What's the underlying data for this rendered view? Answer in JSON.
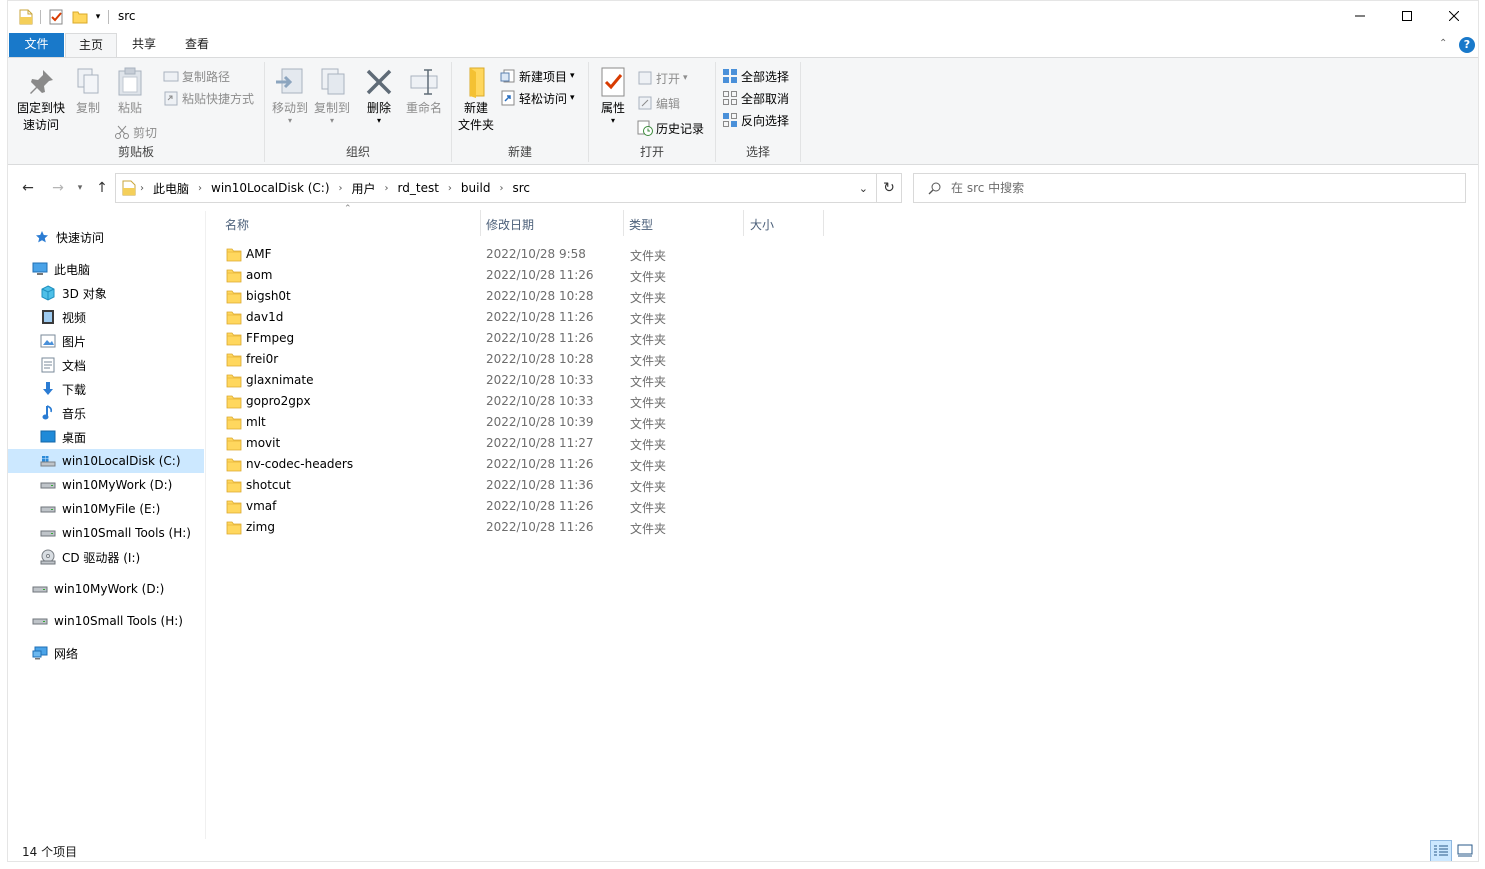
{
  "window": {
    "title": "src",
    "controls": {
      "minimize": "minimize",
      "maximize": "maximize",
      "close": "close"
    }
  },
  "tabs": [
    {
      "label": "文件"
    },
    {
      "label": "主页"
    },
    {
      "label": "共享"
    },
    {
      "label": "查看"
    }
  ],
  "ribbon": {
    "clipboard": {
      "label": "剪贴板",
      "pin": "固定到快\n速访问",
      "pin_line1": "固定到快",
      "pin_line2": "速访问",
      "copy": "复制",
      "paste": "粘贴",
      "copy_path": "复制路径",
      "paste_shortcut": "粘贴快捷方式",
      "cut": "剪切"
    },
    "organize": {
      "label": "组织",
      "move_to": "移动到",
      "copy_to": "复制到",
      "delete": "删除",
      "rename": "重命名"
    },
    "new": {
      "label": "新建",
      "new_folder_line1": "新建",
      "new_folder_line2": "文件夹",
      "new_item": "新建项目",
      "easy_access": "轻松访问"
    },
    "open": {
      "label": "打开",
      "properties": "属性",
      "open": "打开",
      "edit": "编辑",
      "history": "历史记录"
    },
    "select": {
      "label": "选择",
      "select_all": "全部选择",
      "select_none": "全部取消",
      "invert": "反向选择"
    }
  },
  "address": {
    "crumbs": [
      "此电脑",
      "win10LocalDisk (C:)",
      "用户",
      "rd_test",
      "build",
      "src"
    ]
  },
  "search": {
    "placeholder": "在 src 中搜索"
  },
  "nav": {
    "quick_access": "快速访问",
    "this_pc": "此电脑",
    "items": [
      {
        "label": "3D 对象",
        "icon": "3d-objects-icon"
      },
      {
        "label": "视频",
        "icon": "video-icon"
      },
      {
        "label": "图片",
        "icon": "pictures-icon"
      },
      {
        "label": "文档",
        "icon": "documents-icon"
      },
      {
        "label": "下载",
        "icon": "download-icon"
      },
      {
        "label": "音乐",
        "icon": "music-icon"
      },
      {
        "label": "桌面",
        "icon": "desktop-icon"
      },
      {
        "label": "win10LocalDisk (C:)",
        "icon": "drive-icon"
      },
      {
        "label": "win10MyWork (D:)",
        "icon": "drive-icon"
      },
      {
        "label": "win10MyFile (E:)",
        "icon": "drive-icon"
      },
      {
        "label": "win10Small Tools (H:)",
        "icon": "drive-icon"
      },
      {
        "label": "CD 驱动器 (I:)",
        "icon": "cd-drive-icon"
      }
    ],
    "extra": [
      {
        "label": "win10MyWork (D:)"
      },
      {
        "label": "win10Small Tools (H:)"
      }
    ],
    "network": "网络"
  },
  "columns": {
    "name": "名称",
    "date": "修改日期",
    "type": "类型",
    "size": "大小"
  },
  "files": [
    {
      "name": "AMF",
      "date": "2022/10/28 9:58",
      "type": "文件夹"
    },
    {
      "name": "aom",
      "date": "2022/10/28 11:26",
      "type": "文件夹"
    },
    {
      "name": "bigsh0t",
      "date": "2022/10/28 10:28",
      "type": "文件夹"
    },
    {
      "name": "dav1d",
      "date": "2022/10/28 11:26",
      "type": "文件夹"
    },
    {
      "name": "FFmpeg",
      "date": "2022/10/28 11:26",
      "type": "文件夹"
    },
    {
      "name": "frei0r",
      "date": "2022/10/28 10:28",
      "type": "文件夹"
    },
    {
      "name": "glaxnimate",
      "date": "2022/10/28 10:33",
      "type": "文件夹"
    },
    {
      "name": "gopro2gpx",
      "date": "2022/10/28 10:33",
      "type": "文件夹"
    },
    {
      "name": "mlt",
      "date": "2022/10/28 10:39",
      "type": "文件夹"
    },
    {
      "name": "movit",
      "date": "2022/10/28 11:27",
      "type": "文件夹"
    },
    {
      "name": "nv-codec-headers",
      "date": "2022/10/28 11:26",
      "type": "文件夹"
    },
    {
      "name": "shotcut",
      "date": "2022/10/28 11:36",
      "type": "文件夹"
    },
    {
      "name": "vmaf",
      "date": "2022/10/28 11:26",
      "type": "文件夹"
    },
    {
      "name": "zimg",
      "date": "2022/10/28 11:26",
      "type": "文件夹"
    }
  ],
  "status": {
    "text": "14 个项目"
  },
  "colors": {
    "accent": "#1979ca",
    "selection": "#cce8ff",
    "folder": "#ffd75e"
  }
}
